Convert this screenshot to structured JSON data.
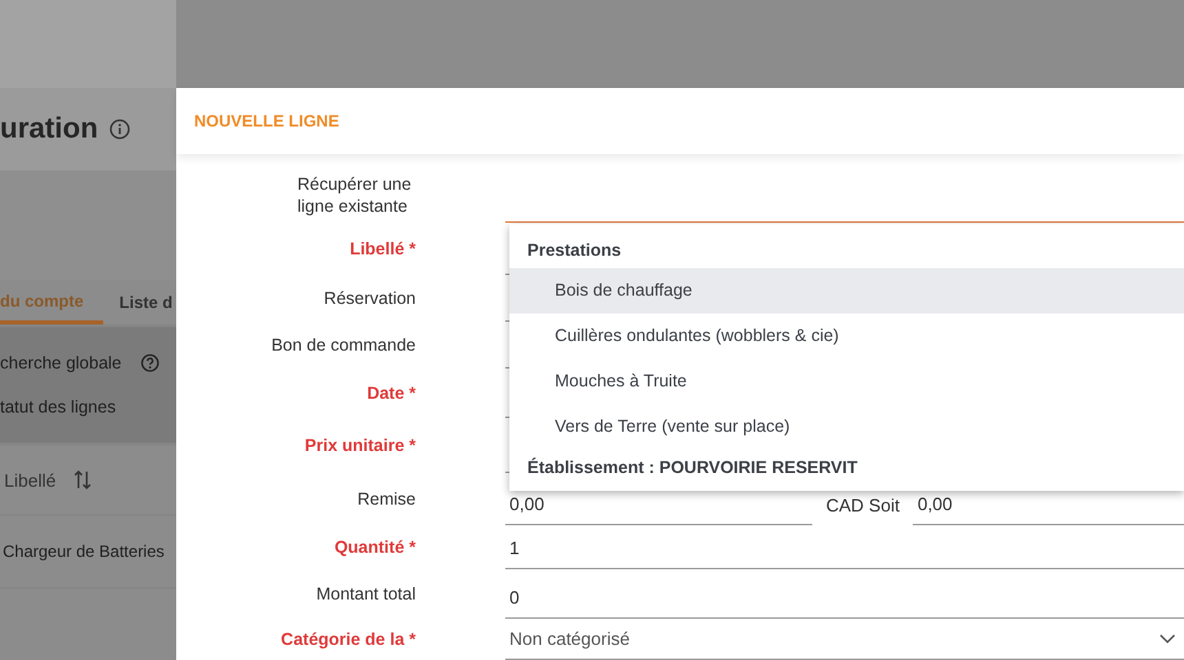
{
  "page": {
    "title": "uration",
    "tabs": [
      {
        "label": "du compte",
        "selected": true
      },
      {
        "label": "Liste d",
        "selected": false
      }
    ],
    "filters": [
      "cherche globale",
      "tatut des lignes"
    ],
    "table": {
      "columns": [
        "Libellé"
      ],
      "rows": [
        "Chargeur de Batteries"
      ]
    }
  },
  "dialog": {
    "title": "NOUVELLE LIGNE",
    "fields": [
      {
        "label": "Récupérer une ligne existante",
        "required": false,
        "kind": "text",
        "focused": true
      },
      {
        "label": "Libellé *",
        "required": true,
        "kind": "text"
      },
      {
        "label": "Réservation",
        "required": false,
        "kind": "text"
      },
      {
        "label": "Bon de commande",
        "required": false,
        "kind": "text"
      },
      {
        "label": "Date *",
        "required": true,
        "kind": "text"
      },
      {
        "label": "Prix unitaire *",
        "required": true,
        "kind": "text"
      },
      {
        "label": "Remise",
        "required": false,
        "kind": "split",
        "value": "0,00",
        "middle": "CAD Soit",
        "value_2": "0,00"
      },
      {
        "label": "Quantité *",
        "required": true,
        "kind": "text",
        "focused": false,
        "value": "1"
      },
      {
        "label": "Montant total",
        "required": false,
        "kind": "text",
        "focused": false,
        "value": "0"
      },
      {
        "label": "Catégorie de la *",
        "required": true,
        "kind": "select",
        "value": "Non catégorisé"
      }
    ],
    "dropdown": [
      {
        "title": "Prestations",
        "items": [
          {
            "label": "Bois de chauffage",
            "selected": true
          },
          {
            "label": "Cuillères ondulantes (wobblers & cie)",
            "selected": false
          },
          {
            "label": "Mouches à Truite",
            "selected": false
          },
          {
            "label": "Vers de Terre (vente sur place)",
            "selected": false
          }
        ]
      },
      {
        "title": "Établissement : POURVOIRIE RESERVIT"
      }
    ]
  }
}
